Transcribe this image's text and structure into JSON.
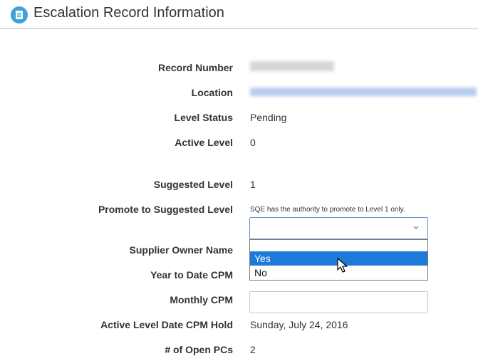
{
  "header": {
    "title": "Escalation Record Information",
    "icon": "document-icon",
    "icon_color": "#3ea2d8"
  },
  "fields": {
    "record_number": {
      "label": "Record Number",
      "value": ""
    },
    "location": {
      "label": "Location",
      "value": ""
    },
    "level_status": {
      "label": "Level Status",
      "value": "Pending"
    },
    "active_level": {
      "label": "Active Level",
      "value": "0"
    },
    "suggested_level": {
      "label": "Suggested Level",
      "value": "1"
    },
    "promote": {
      "label": "Promote to Suggested Level",
      "hint": "SQE has the authority to promote to Level 1 only.",
      "selected": "",
      "options": [
        "Yes",
        "No"
      ],
      "highlighted": "Yes"
    },
    "supplier_owner_name": {
      "label": "Supplier Owner Name"
    },
    "ytd_cpm": {
      "label": "Year to Date CPM"
    },
    "monthly_cpm": {
      "label": "Monthly CPM",
      "value": ""
    },
    "active_level_date": {
      "label": "Active Level Date CPM Hold",
      "value": "Sunday, July 24, 2016"
    },
    "open_pcs": {
      "label": "# of Open PCs",
      "value": "2"
    }
  },
  "colors": {
    "accent": "#3ea2d8",
    "highlight": "#1e7ad9",
    "link": "#4a7fd4"
  }
}
